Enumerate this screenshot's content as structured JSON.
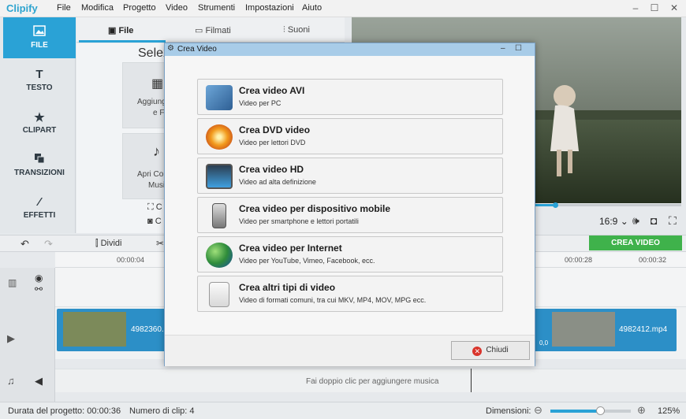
{
  "app": {
    "name": "Clipify",
    "brand_color": "#2ea4cf"
  },
  "menu": [
    "File",
    "Modifica",
    "Progetto",
    "Video",
    "Strumenti",
    "Impostazioni",
    "Aiuto"
  ],
  "window_controls": {
    "minimize": "–",
    "maximize": "☐",
    "close": "✕"
  },
  "sidebar": [
    {
      "label": "FILE",
      "icon": "image-icon"
    },
    {
      "label": "TESTO",
      "icon": "text-icon"
    },
    {
      "label": "CLIPART",
      "icon": "star-icon"
    },
    {
      "label": "TRANSIZIONI",
      "icon": "transitions-icon"
    },
    {
      "label": "EFFETTI",
      "icon": "magic-wand-icon"
    }
  ],
  "tabs": [
    "File",
    "Filmati",
    "Suoni"
  ],
  "content": {
    "heading": "Selez",
    "card1_line1": "Aggiung",
    "card1_line2": "e F",
    "card2_line1": "Apri Col",
    "card2_line2": "Musi",
    "misc1": "C",
    "misc2": "C"
  },
  "preview": {
    "aspect": "16:9 ⌄",
    "create_button": "CREA VIDEO"
  },
  "toolbar": {
    "split": "Dividi"
  },
  "ruler": [
    "00:00:04",
    "00:00:28",
    "00:00:32"
  ],
  "timeline": {
    "clip1": "4982360.",
    "clip2": "4982412.mp4",
    "clip_time": "0,0",
    "music_hint": "Fai doppio clic per aggiungere musica"
  },
  "status": {
    "duration": "Durata del progetto:  00:00:36",
    "clips": "Numero di clip: 4",
    "dimensions_label": "Dimensioni:",
    "zoom": "125%",
    "zoom_level": 0.62
  },
  "dialog": {
    "title": "Crea Video",
    "options": [
      {
        "title": "Crea video AVI",
        "subtitle": "Video per PC",
        "icon": "avi-film-icon"
      },
      {
        "title": "Crea DVD video",
        "subtitle": "Video per lettori DVD",
        "icon": "dvd-disc-icon"
      },
      {
        "title": "Crea video HD",
        "subtitle": "Video ad alta definizione",
        "icon": "hd-monitor-icon"
      },
      {
        "title": "Crea video per dispositivo mobile",
        "subtitle": "Video per smartphone e lettori portatili",
        "icon": "mobile-phone-icon"
      },
      {
        "title": "Crea video per Internet",
        "subtitle": "Video per YouTube, Vimeo, Facebook, ecc.",
        "icon": "globe-icon"
      },
      {
        "title": "Crea altri tipi di video",
        "subtitle": "Video di formati comuni, tra cui MKV, MP4, MOV, MPG ecc.",
        "icon": "video-file-icon"
      }
    ],
    "close_label": "Chiudi"
  }
}
